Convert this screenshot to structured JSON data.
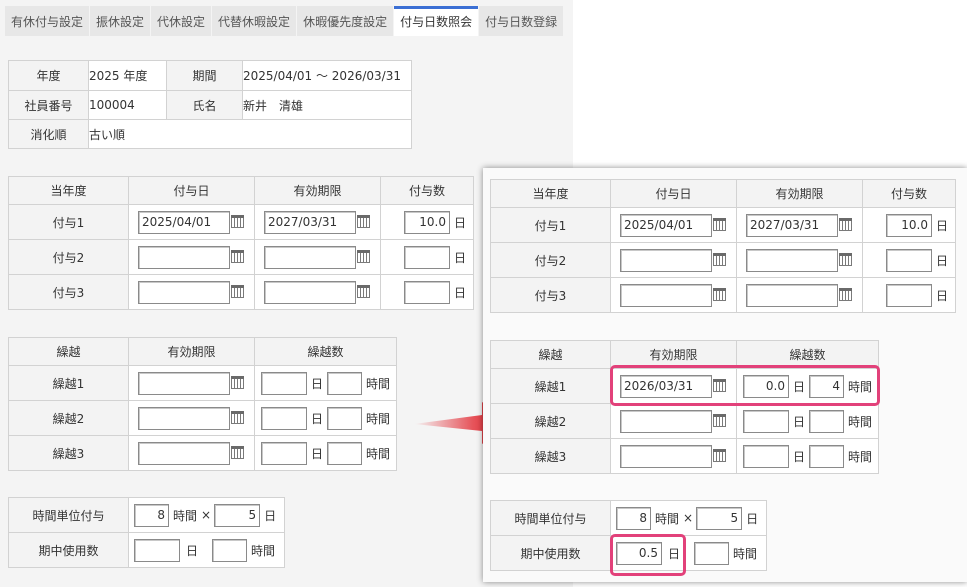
{
  "tabs": [
    {
      "label": "有休付与設定"
    },
    {
      "label": "振休設定"
    },
    {
      "label": "代休設定"
    },
    {
      "label": "代替休暇設定"
    },
    {
      "label": "休暇優先度設定"
    },
    {
      "label": "付与日数照会"
    },
    {
      "label": "付与日数登録"
    }
  ],
  "info": {
    "nendo_label": "年度",
    "nendo_value": "2025 年度",
    "kikan_label": "期間",
    "kikan_value": "2025/04/01 ～ 2026/03/31",
    "shain_label": "社員番号",
    "shain_value": "100004",
    "shimei_label": "氏名",
    "shimei_value": "新井　清雄",
    "shoka_label": "消化順",
    "shoka_value": "古い順"
  },
  "grant_headers": [
    "当年度",
    "付与日",
    "有効期限",
    "付与数"
  ],
  "grant_rows": [
    {
      "label": "付与1",
      "date": "2025/04/01",
      "expiry": "2027/03/31",
      "days": "10.0"
    },
    {
      "label": "付与2",
      "date": "",
      "expiry": "",
      "days": ""
    },
    {
      "label": "付与3",
      "date": "",
      "expiry": "",
      "days": ""
    }
  ],
  "carry_headers": [
    "繰越",
    "有効期限",
    "繰越数"
  ],
  "carry_rows_before": [
    {
      "label": "繰越1",
      "expiry": "",
      "days": "",
      "hours": ""
    },
    {
      "label": "繰越2",
      "expiry": "",
      "days": "",
      "hours": ""
    },
    {
      "label": "繰越3",
      "expiry": "",
      "days": "",
      "hours": ""
    }
  ],
  "carry_rows_after": [
    {
      "label": "繰越1",
      "expiry": "2026/03/31",
      "days": "0.0",
      "hours": "4"
    },
    {
      "label": "繰越2",
      "expiry": "",
      "days": "",
      "hours": ""
    },
    {
      "label": "繰越3",
      "expiry": "",
      "days": "",
      "hours": ""
    }
  ],
  "units": {
    "day": "日",
    "hour": "時間",
    "times": "×"
  },
  "hourly": {
    "label": "時間単位付与",
    "hours": "8",
    "days": "5",
    "used_label": "期中使用数",
    "used_days_before": "",
    "used_hours_before": "",
    "used_days_after": "0.5",
    "used_hours_after": ""
  },
  "colors": {
    "highlight": "#e2417a",
    "active_tab": "#3b6fd4",
    "arrow": "#e0101a"
  }
}
